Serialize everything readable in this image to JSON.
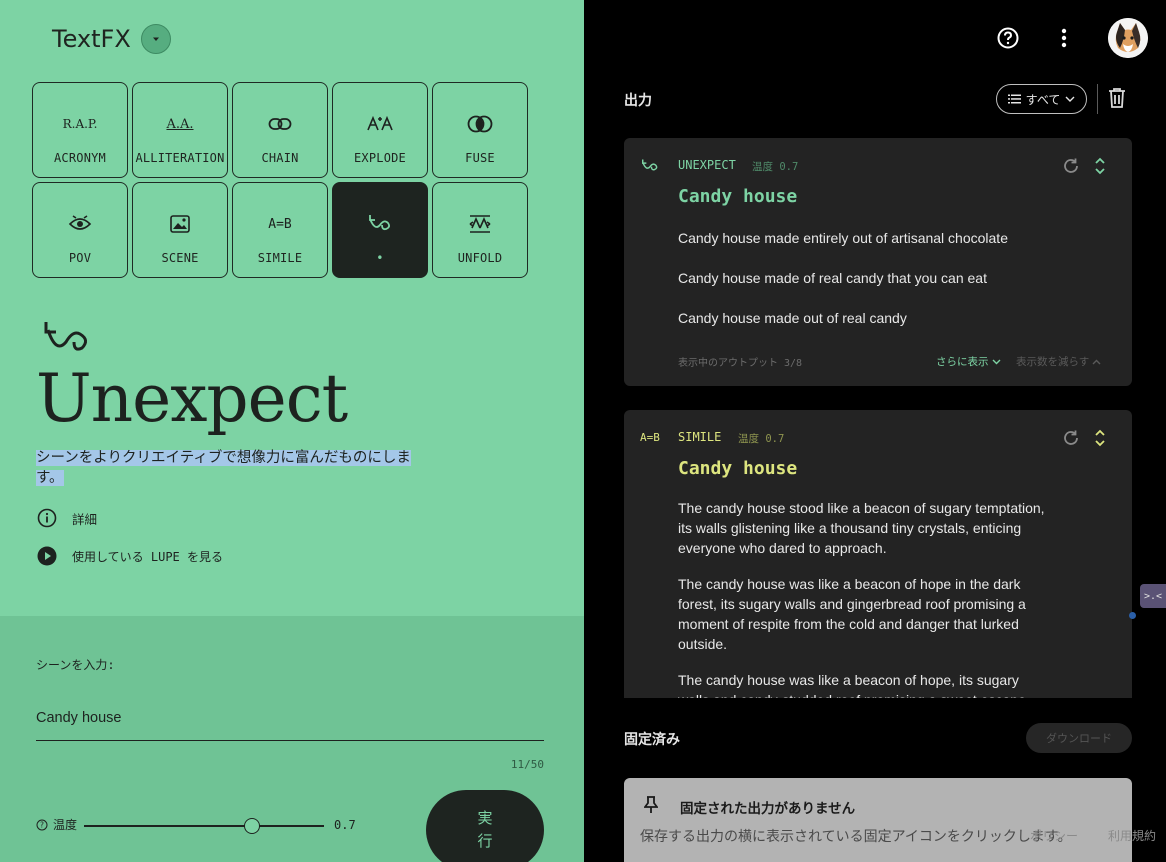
{
  "app": {
    "title": "TextFX"
  },
  "tools": [
    {
      "label": "ACRONYM",
      "icon": "acronym-icon",
      "glyph": "R.A.P."
    },
    {
      "label": "ALLITERATION",
      "icon": "alliteration-icon",
      "glyph": "A.A."
    },
    {
      "label": "CHAIN",
      "icon": "chain-link-icon"
    },
    {
      "label": "EXPLODE",
      "icon": "explode-icon"
    },
    {
      "label": "FUSE",
      "icon": "fuse-icon"
    },
    {
      "label": "POV",
      "icon": "pov-eye-icon"
    },
    {
      "label": "SCENE",
      "icon": "scene-image-icon"
    },
    {
      "label": "SIMILE",
      "icon": "simile-icon",
      "glyph": "A=B"
    },
    {
      "label": "•",
      "icon": "unexpect-icon",
      "active": true
    },
    {
      "label": "UNFOLD",
      "icon": "unfold-icon"
    }
  ],
  "main": {
    "title": "Unexpect",
    "description": "シーンをよりクリエイティブで想像力に富んだものにします。",
    "details_label": "詳細",
    "watch_label": "使用している LUPE を見る"
  },
  "input": {
    "label": "シーンを入力:",
    "value": "Candy house",
    "counter": "11/50",
    "temperature_label": "温度",
    "temperature_value": "0.7",
    "temperature_fraction": 0.7,
    "run_label": "実行"
  },
  "output": {
    "heading": "出力",
    "filter_label": "すべて",
    "cards": [
      {
        "tool": "UNEXPECT",
        "temp_label": "温度 0.7",
        "title": "Candy house",
        "items": [
          "Candy house made entirely out of artisanal chocolate",
          "Candy house made of real candy that you can eat",
          "Candy house made out of real candy"
        ],
        "footer": "表示中のアウトプット 3/8",
        "more_label": "さらに表示",
        "less_label": "表示数を減らす"
      },
      {
        "tool": "SIMILE",
        "tool_glyph": "A=B",
        "temp_label": "温度 0.7",
        "title": "Candy house",
        "items": [
          "The candy house stood like a beacon of sugary temptation, its walls glistening like a thousand tiny crystals, enticing everyone who dared to approach.",
          "The candy house was like a beacon of hope in the dark forest, its sugary walls and gingerbread roof promising a moment of respite from the cold and danger that lurked outside.",
          "The candy house was like a beacon of hope, its sugary walls and candy-studded roof promising a sweet escape"
        ]
      }
    ]
  },
  "pinned": {
    "heading": "固定済み",
    "download_label": "ダウンロード",
    "empty_title": "固定された出力がありません",
    "empty_text": "保存する出力の横に表示されている固定アイコンをクリックします。"
  },
  "footer": {
    "privacy": "ポリシー",
    "terms": "利用規約"
  },
  "colors": {
    "accent": "#7dd3a4",
    "simile": "#dde57f",
    "dark": "#1e2420"
  }
}
